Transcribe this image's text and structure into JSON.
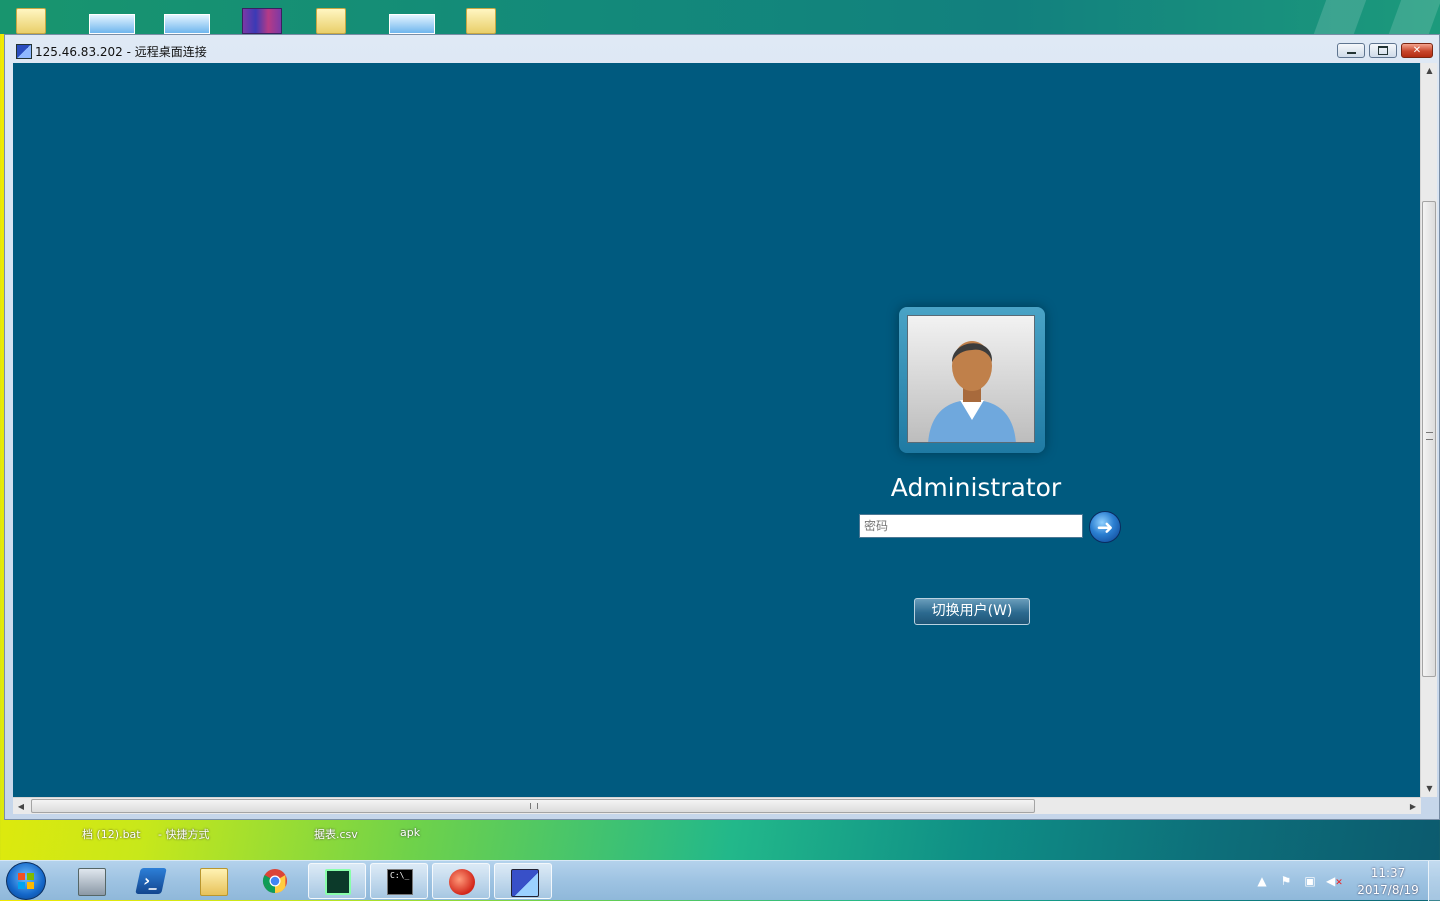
{
  "window": {
    "title": "125.46.83.202 - 远程桌面连接",
    "controls": {
      "minimize": "minimize",
      "maximize": "restore",
      "close": "close"
    }
  },
  "login": {
    "username": "Administrator",
    "password_placeholder": "密码",
    "submit_icon": "arrow-right-icon",
    "switch_user_label": "切换用户(W)"
  },
  "desktop": {
    "top_icons": [
      "folder-icon",
      "picture-icon",
      "picture-icon",
      "winrar-icon",
      "folder-icon",
      "picture-icon",
      "folder-icon"
    ],
    "bottom_labels": [
      "档 (12).bat",
      "- 快捷方式",
      "据表.csv",
      "apk"
    ]
  },
  "taskbar": {
    "apps": [
      "server-manager-icon",
      "powershell-icon",
      "file-explorer-icon",
      "chrome-icon",
      "monitor-app-icon",
      "cmd-icon",
      "snail-app-icon",
      "remote-desktop-icon"
    ],
    "active_apps": [
      "monitor-app-icon",
      "cmd-icon",
      "snail-app-icon",
      "remote-desktop-icon"
    ],
    "tray": {
      "time": "11:37",
      "date": "2017/8/19",
      "icons": [
        "show-hidden-icons-icon",
        "action-center-flag-icon",
        "network-icon",
        "volume-muted-icon"
      ]
    }
  },
  "colors": {
    "session_background": "#005a7f",
    "accent": "#2b7fd1",
    "taskbar": "#9ec3e2"
  }
}
